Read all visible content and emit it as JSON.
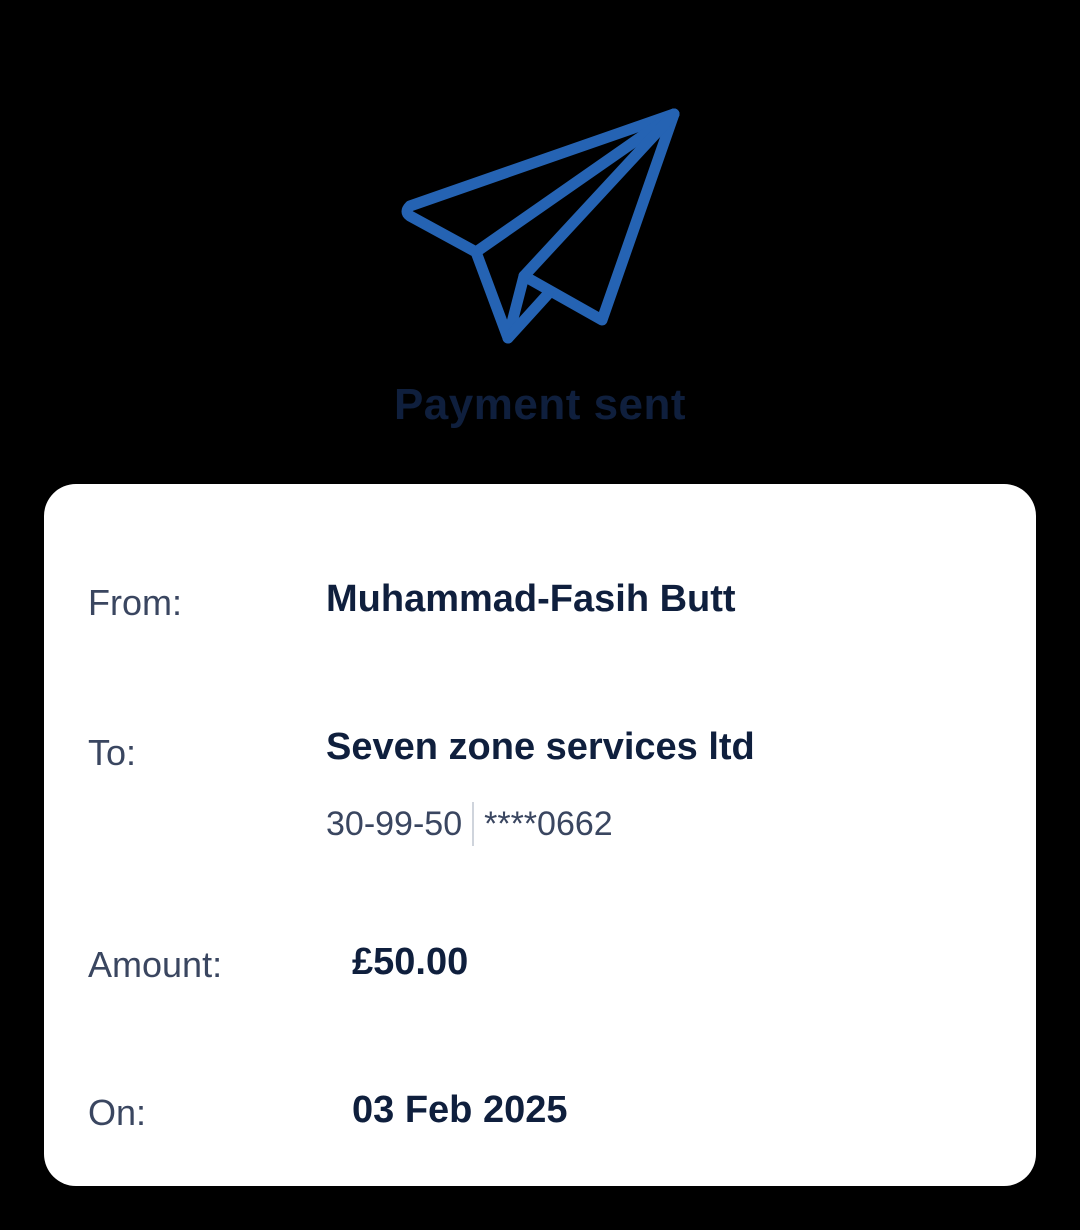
{
  "header": {
    "icon": "paper-plane-icon",
    "title": "Payment sent",
    "accent_color": "#2563b3",
    "title_color": "#0f1f3d"
  },
  "details": {
    "from": {
      "label": "From:",
      "value": "Muhammad-Fasih Butt"
    },
    "to": {
      "label": "To:",
      "value": "Seven zone services ltd",
      "sort_code": "30-99-50",
      "account_number": "****0662"
    },
    "amount": {
      "label": "Amount:",
      "value": "£50.00"
    },
    "date": {
      "label": "On:",
      "value": "03 Feb 2025"
    }
  }
}
